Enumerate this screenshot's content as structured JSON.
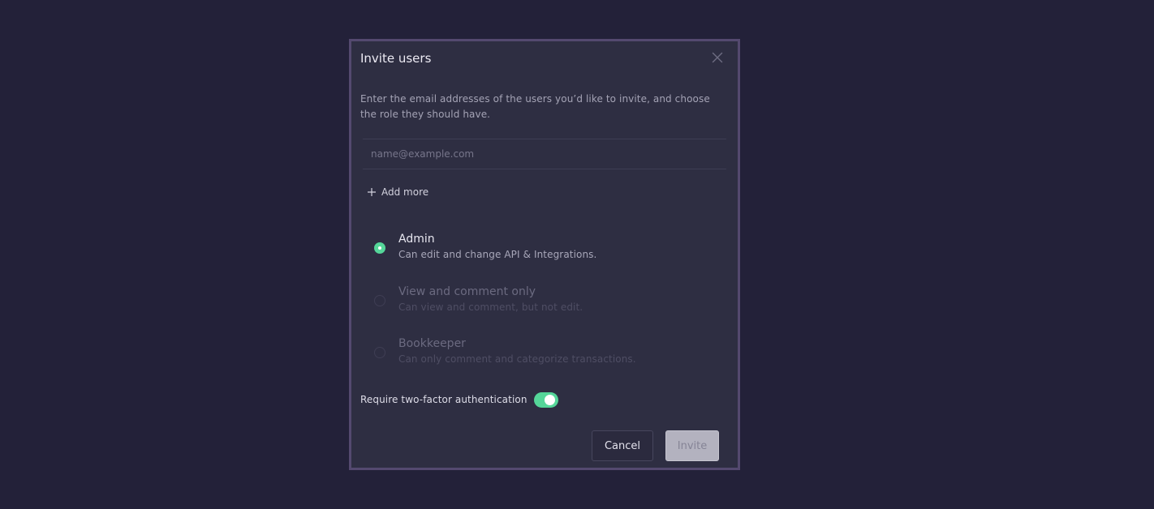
{
  "dialog": {
    "title": "Invite users",
    "description": "Enter the email addresses of the users you’d like to invite, and choose the role they should have.",
    "email_placeholder": "name@example.com",
    "email_value": "",
    "add_more_label": "Add more",
    "roles": [
      {
        "label": "Admin",
        "description": "Can edit and change API & Integrations.",
        "selected": true
      },
      {
        "label": "View and comment only",
        "description": "Can view and comment, but not edit.",
        "selected": false
      },
      {
        "label": "Bookkeeper",
        "description": "Can only comment and categorize transactions.",
        "selected": false
      }
    ],
    "two_factor_label": "Require two-factor authentication",
    "two_factor_enabled": true,
    "cancel_label": "Cancel",
    "invite_label": "Invite"
  },
  "icons": {
    "close": "close-icon",
    "add": "plus-icon"
  },
  "colors": {
    "background": "#232139",
    "dialog": "#2e2e42",
    "dialog_border": "#54496f",
    "accent": "#55d699",
    "invite_button": "#b3b2bf"
  }
}
